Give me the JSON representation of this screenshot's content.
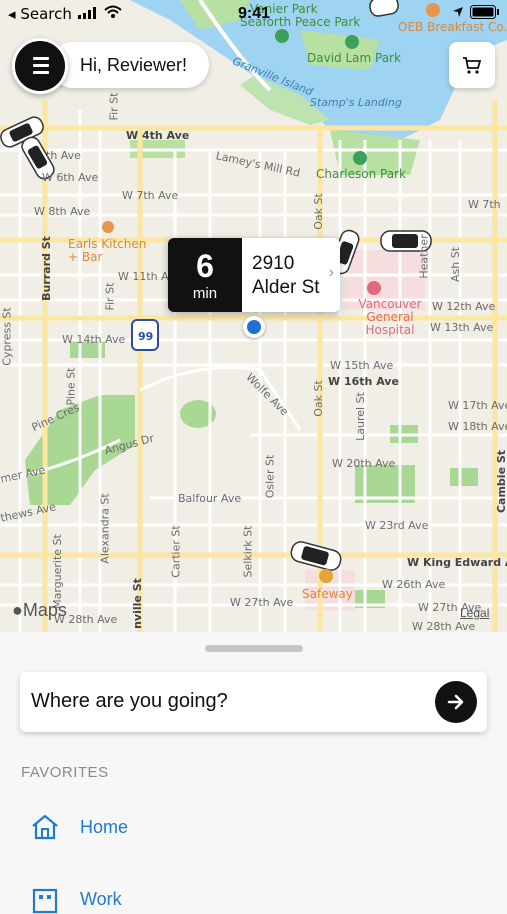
{
  "status_bar": {
    "back_label": "Search",
    "time": "9:41"
  },
  "header": {
    "greeting": "Hi, Reviewer!"
  },
  "eta": {
    "minutes": "6",
    "unit": "min",
    "address_line1": "2910",
    "address_line2": "Alder St"
  },
  "map": {
    "attribution": "Maps",
    "legal": "Legal",
    "labels": {
      "vanier_park": "Vanier Park",
      "seaforth_peace_park": "Seaforth Peace Park",
      "oeb": "OEB Breakfast Co.",
      "david_lam_park": "David Lam Park",
      "granville_island": "Granville Island",
      "stamps_landing": "Stamp's Landing",
      "charleson_park": "Charleson Park",
      "w4th": "W 4th Ave",
      "lamey": "Lamey's Mill Rd",
      "w7th": "W 7th Ave",
      "w7th_r": "W 7th",
      "w8th": "W 8th Ave",
      "w5th": "th Ave",
      "w6th": "W 6th Ave",
      "earls": "Earls Kitchen + Bar",
      "w11th": "W 11th Ave",
      "w12th": "W 12th Ave",
      "w13th": "W 13th Ave",
      "w14th": "W 14th Ave",
      "vgh": "Vancouver General Hospital",
      "w15th": "W 15th Ave",
      "w16th": "W 16th Ave",
      "w17th": "W 17th Ave",
      "w18th": "W 18th Ave",
      "w20th": "W 20th Ave",
      "w23rd": "W 23rd Ave",
      "king_edward": "W King Edward Ave",
      "w26th": "W 26th Ave",
      "w27th": "W 27th Ave",
      "w27th_r": "W 27th Ave",
      "w28th": "W 28th Ave",
      "w28th_r": "W 28th Ave",
      "wolfe": "Wolfe Ave",
      "angus": "Angus Dr",
      "pine_cres": "Pine Cres",
      "balfour": "Balfour Ave",
      "matthews": "thews Ave",
      "cypress": "Cypress St",
      "burrard": "Burrard St",
      "pine_st": "Pine St",
      "fir_st": "Fir St",
      "alexandra": "Alexandra St",
      "marguerite": "Marguerite St",
      "granville_st": "nville St",
      "cartier": "Cartier St",
      "selkirk": "Selkirk St",
      "osler": "Osler St",
      "oak_st": "Oak St",
      "laurel": "Laurel St",
      "heather": "Heather",
      "ash": "Ash St",
      "cambie": "Cambie St",
      "safeway": "Safeway",
      "route_99": "99",
      "mer_ave": "mer Ave"
    }
  },
  "sheet": {
    "search_placeholder": "Where are you going?",
    "favorites_heading": "FAVORITES",
    "favorites": [
      {
        "label": "Home",
        "icon": "home-icon"
      },
      {
        "label": "Work",
        "icon": "work-icon"
      }
    ]
  },
  "colors": {
    "accent": "#1f7ad0",
    "water": "#9fd3f2",
    "park": "#b9e0a3"
  }
}
